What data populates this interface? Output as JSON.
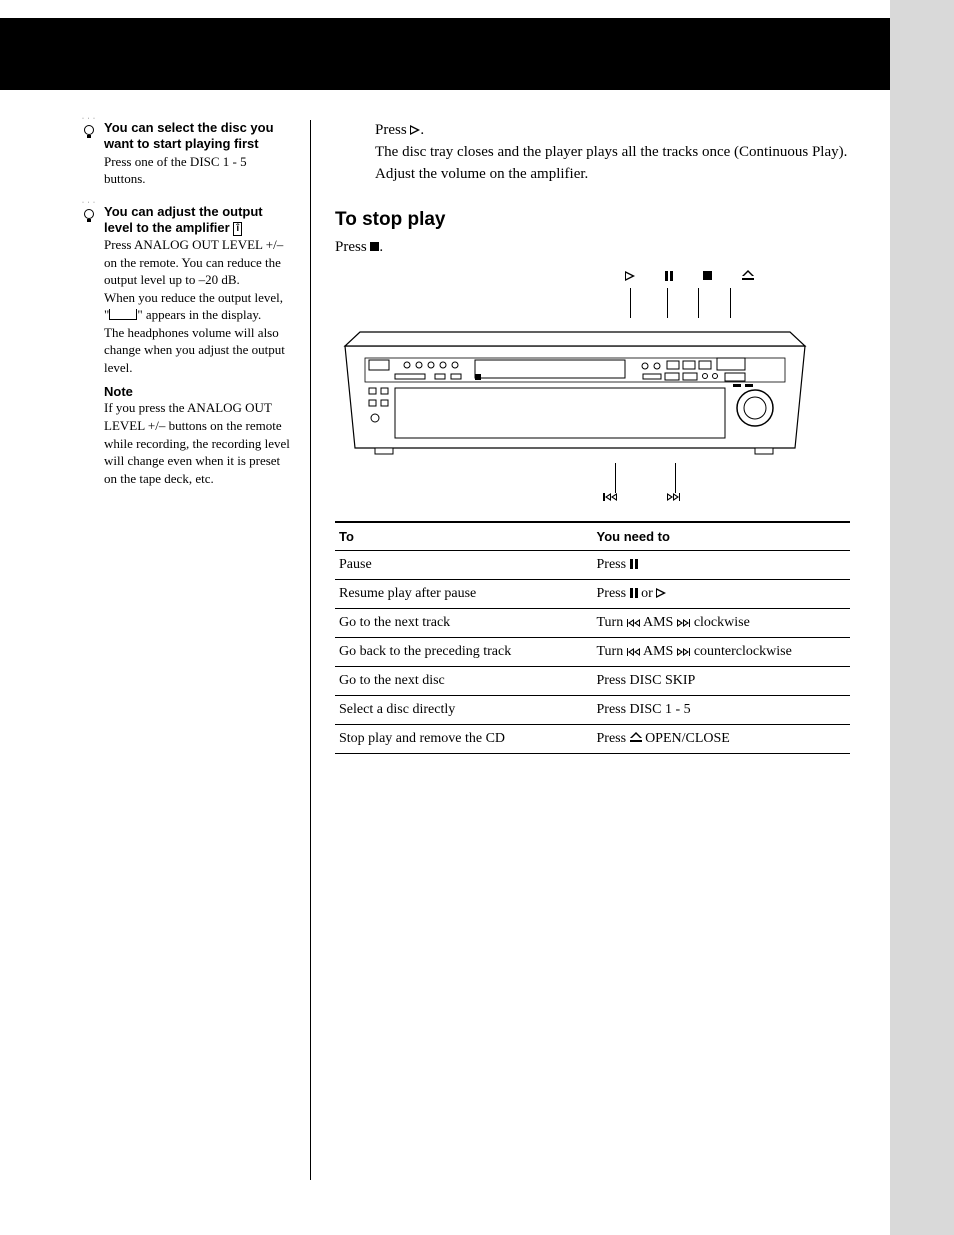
{
  "sidebar": {
    "tip1": {
      "title": "You can select the disc you want to start playing first",
      "text": "Press one of the DISC 1 - 5 buttons."
    },
    "tip2": {
      "title_prefix": "You can adjust the output level to the amplifier",
      "para1": "Press ANALOG OUT LEVEL +/– on the remote. You can reduce the output level up to –20 dB.",
      "para2_pre": "When you reduce the output level, \"",
      "para2_post": "\" appears in the display.",
      "para3": "The headphones volume will also change when you adjust the output level."
    },
    "note": {
      "title": "Note",
      "text": "If you press the ANALOG OUT LEVEL +/– buttons on the remote while recording, the recording level will change even when it is preset on the tape deck, etc."
    }
  },
  "main": {
    "intro_line1_pre": "Press ",
    "intro_line1_post": ".",
    "intro_line2": "The disc tray closes and the player plays all the tracks once (Continuous Play). Adjust the volume on the amplifier.",
    "section_title": "To stop play",
    "section_sub_pre": "Press ",
    "section_sub_post": "."
  },
  "table": {
    "head_to": "To",
    "head_need": "You need to",
    "rows": [
      {
        "to": "Pause",
        "need_pre": "Press ",
        "icons": [
          "pause"
        ],
        "need_post": ""
      },
      {
        "to": "Resume play after pause",
        "need_pre": "Press ",
        "icons": [
          "pause",
          "or",
          "play"
        ],
        "need_post": ""
      },
      {
        "to": "Go to the next track",
        "need_pre": "Turn ",
        "icons": [
          "prev",
          "ams",
          "next"
        ],
        "need_post": " clockwise"
      },
      {
        "to": "Go back to the preceding track",
        "need_pre": "Turn ",
        "icons": [
          "prev",
          "ams",
          "next"
        ],
        "need_post": " counterclockwise"
      },
      {
        "to": "Go to the next disc",
        "need_pre": "Press DISC SKIP",
        "icons": [],
        "need_post": ""
      },
      {
        "to": "Select a disc directly",
        "need_pre": "Press DISC 1 - 5",
        "icons": [],
        "need_post": ""
      },
      {
        "to": "Stop play and remove the CD",
        "need_pre": "Press ",
        "icons": [
          "eject"
        ],
        "need_post": " OPEN/CLOSE"
      }
    ]
  },
  "labels": {
    "ams": "AMS",
    "or": "or"
  }
}
